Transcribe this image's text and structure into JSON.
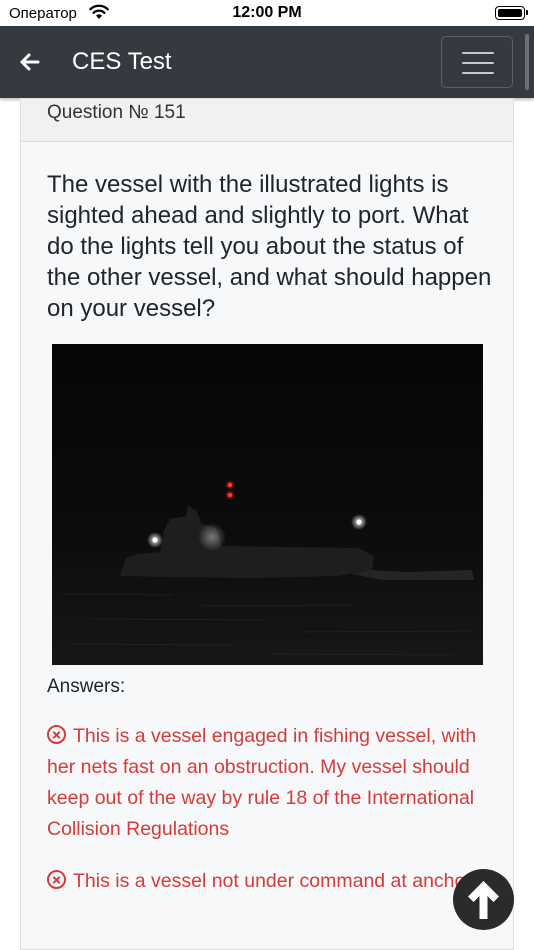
{
  "status_bar": {
    "carrier": "Оператор",
    "time": "12:00 PM"
  },
  "header": {
    "title": "CES Test",
    "back_icon": "arrow-left-icon",
    "menu_icon": "hamburger-menu-icon"
  },
  "question": {
    "number": "Question № 151",
    "text": "The vessel with the illustrated lights is sighted ahead and slightly to port. What do the lights tell you about the status of the other vessel, and what should happen on your vessel?"
  },
  "answers": {
    "label": "Answers:",
    "items": [
      {
        "text": "This is a vessel engaged in fishing vessel, with her nets fast on an obstruction. My vessel should keep out of the way by rule 18 of the International Collision Regulations",
        "status": "incorrect",
        "icon": "x-circle-icon"
      },
      {
        "text": "This is a vessel not under command at anchor",
        "status": "incorrect",
        "icon": "x-circle-icon"
      }
    ]
  },
  "colors": {
    "navbar": "#343a40",
    "wrong_answer": "#d43b3b",
    "card_background": "#f7f8f9"
  },
  "scroll_top_icon": "arrow-up-icon"
}
